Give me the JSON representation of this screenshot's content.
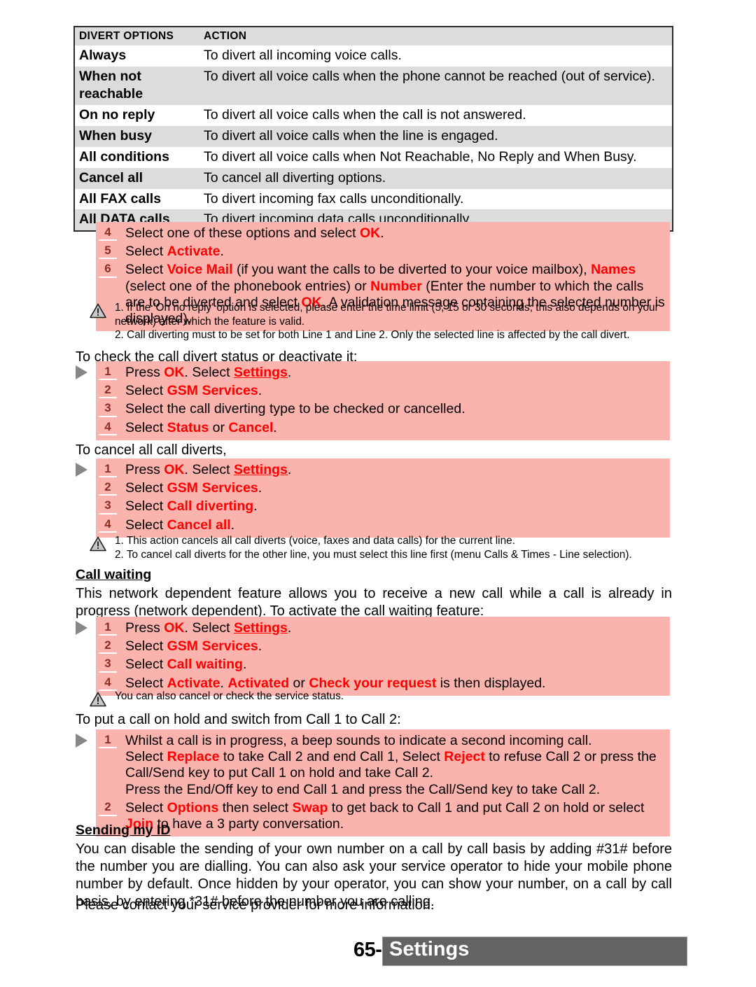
{
  "table": {
    "headers": [
      "DIVERT OPTIONS",
      "ACTION"
    ],
    "rows": [
      {
        "option": "Always",
        "action": "To divert all incoming voice calls.",
        "shaded": false
      },
      {
        "option": "When not reachable",
        "action": "To divert all voice calls when the phone cannot be reached (out of service).",
        "shaded": true
      },
      {
        "option": "On no reply",
        "action": "To divert all voice calls when the call is not answered.",
        "shaded": false
      },
      {
        "option": "When busy",
        "action": "To divert all voice calls when the line is engaged.",
        "shaded": true
      },
      {
        "option": "All conditions",
        "action": "To divert all voice calls when Not Reachable, No Reply and When Busy.",
        "shaded": false
      },
      {
        "option": "Cancel all",
        "action": "To cancel all diverting options.",
        "shaded": true
      },
      {
        "option": "All FAX calls",
        "action": "To divert incoming fax calls unconditionally.",
        "shaded": false
      },
      {
        "option": "All DATA calls",
        "action": "To divert incoming data calls unconditionally.",
        "shaded": true
      }
    ]
  },
  "steps_divert": {
    "num4": "4",
    "num5": "5",
    "num6": "6",
    "s4_a": "Select one of these options and select ",
    "s4_ok": "OK",
    "s4_b": ".",
    "s5_a": "Select ",
    "s5_activate": "Activate",
    "s5_b": ".",
    "s6_a": "Select ",
    "s6_voicemail": "Voice Mail",
    "s6_b": " (if you want the calls to be diverted to your voice mailbox), ",
    "s6_names": "Names",
    "s6_c": " (select one of the phonebook entries) or ",
    "s6_number": "Number",
    "s6_d": " (Enter the number to which the calls are to be diverted and select ",
    "s6_ok": "OK",
    "s6_e": ". A validation message containing the selected number is displayed)."
  },
  "note_divert": {
    "line1": "1. If the 'On no reply' option is selected, please enter the time limit (5, 15 or 30 seconds; this also depends on your network) after which the feature is valid.",
    "line2": "2. Call diverting must to be set for both Line 1 and Line 2. Only the selected line is affected by the call divert."
  },
  "check_status": {
    "intro": "To check the call divert status or deactivate it:",
    "num1": "1",
    "num2": "2",
    "num3": "3",
    "num4": "4",
    "s1_a": "Press ",
    "s1_ok": "OK",
    "s1_b": ". Select ",
    "s1_settings": "Settings",
    "s1_c": ".",
    "s2_a": "Select ",
    "s2_gsm": "GSM Services",
    "s2_b": ".",
    "s3": "Select the call diverting type to be checked or cancelled.",
    "s4_a": "Select ",
    "s4_status": "Status",
    "s4_b": " or ",
    "s4_cancel": "Cancel",
    "s4_c": "."
  },
  "cancel_all": {
    "intro": "To cancel all call diverts,",
    "num1": "1",
    "num2": "2",
    "num3": "3",
    "num4": "4",
    "s1_a": "Press ",
    "s1_ok": "OK",
    "s1_b": ". Select ",
    "s1_settings": "Settings",
    "s1_c": ".",
    "s2_a": "Select ",
    "s2_gsm": "GSM Services",
    "s2_b": ".",
    "s3_a": "Select ",
    "s3_calldiverting": "Call diverting",
    "s3_b": ".",
    "s4_a": "Select ",
    "s4_cancelall": "Cancel all",
    "s4_b": "."
  },
  "note_cancel": {
    "line1": "1. This action cancels all call diverts (voice, faxes and data calls) for the current line.",
    "line2": "2. To cancel call diverts for the other line, you must select this line first (menu Calls & Times - Line selection)."
  },
  "call_waiting": {
    "heading": "Call waiting",
    "paragraph": "This network dependent feature allows you to receive a new call while a call is already in progress (network dependent). To activate the call waiting feature:",
    "num1": "1",
    "num2": "2",
    "num3": "3",
    "num4": "4",
    "s1_a": "Press ",
    "s1_ok": "OK",
    "s1_b": ". Select ",
    "s1_settings": "Settings",
    "s1_c": ".",
    "s2_a": "Select ",
    "s2_gsm": "GSM Services",
    "s2_b": ".",
    "s3_a": "Select ",
    "s3_callwaiting": "Call waiting",
    "s3_b": ".",
    "s4_a": "Select ",
    "s4_activate": "Activate",
    "s4_b": ". ",
    "s4_activated": "Activated",
    "s4_c": " or ",
    "s4_check": "Check your request",
    "s4_d": " is then displayed.",
    "note": "You can also cancel or check the service status."
  },
  "hold_switch": {
    "intro": "To put a call on hold and switch from Call 1 to Call 2:",
    "num1": "1",
    "num2": "2",
    "s1_l1": "Whilst a call is in progress, a beep sounds to indicate a second incoming call.",
    "s1_l2_a": "Select ",
    "s1_replace": "Replace",
    "s1_l2_b": " to take Call 2 and end Call 1, Select ",
    "s1_reject": "Reject",
    "s1_l2_c": " to refuse Call 2 or press the Call/Send key to put Call 1 on hold and take Call 2.",
    "s1_l3": "Press the End/Off key to end Call 1 and press the Call/Send key to take Call 2.",
    "s2_a": "Select ",
    "s2_options": "Options",
    "s2_b": " then select ",
    "s2_swap": "Swap",
    "s2_c": " to get back to Call 1 and put Call 2 on hold or select ",
    "s2_join": "Join",
    "s2_d": " to have a 3 party conversation."
  },
  "sending_id": {
    "heading": "Sending my ID",
    "paragraph": "You can disable the sending of your own number on a call by call basis by adding #31# before the number you are dialling. You can also ask your service operator to hide your mobile phone number by default. Once hidden by your operator, you can show your number, on a call by call basis,  by entering *31# before the number you are calling.",
    "paragraph2": "Please contact your service provider for more information."
  },
  "footer": {
    "page_number": "65-",
    "title": "Settings"
  },
  "colors": {
    "pink_block": "#fbb3ae",
    "accent_red": "#fe0000",
    "step_number": "#8f2b22",
    "table_shaded": "#dcdcdc",
    "footer_bar": "#636363",
    "marker_gray": "#878787"
  },
  "icons": {
    "warning": "warning-triangle-icon",
    "step_marker": "right-arrow-marker-icon"
  }
}
